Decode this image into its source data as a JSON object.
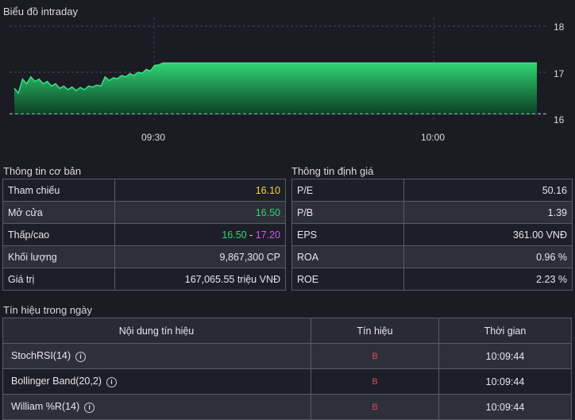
{
  "chart": {
    "title": "Biểu đồ intraday",
    "x_ticks": [
      "09:30",
      "10:00"
    ],
    "y_ticks": [
      "18",
      "17",
      "16"
    ]
  },
  "chart_data": {
    "type": "area",
    "ylim": [
      16,
      18
    ],
    "reference": 16.1,
    "y_ticks": [
      16,
      17,
      18
    ],
    "values": [
      16.65,
      16.55,
      16.85,
      16.75,
      16.9,
      16.8,
      16.85,
      16.75,
      16.8,
      16.7,
      16.75,
      16.65,
      16.7,
      16.62,
      16.68,
      16.6,
      16.67,
      16.62,
      16.7,
      16.68,
      16.72,
      16.7,
      16.9,
      16.82,
      16.88,
      16.86,
      16.93,
      16.9,
      16.97,
      16.93,
      17.0,
      16.98,
      17.06,
      17.03,
      17.15,
      17.16,
      17.2,
      17.2,
      17.2,
      17.2,
      17.2,
      17.2,
      17.2,
      17.2,
      17.2
    ]
  },
  "basic": {
    "heading": "Thông tin cơ bản",
    "rows": [
      {
        "label": "Tham chiếu",
        "value": "16.10"
      },
      {
        "label": "Mở cửa",
        "value": "16.50"
      },
      {
        "label": "Thấp/cao",
        "low": "16.50",
        "sep": " - ",
        "high": "17.20"
      },
      {
        "label": "Khối lượng",
        "value": "9,867,300 CP"
      },
      {
        "label": "Giá trị",
        "value": "167,065.55 triệu VNĐ"
      }
    ]
  },
  "valuation": {
    "heading": "Thông tin định giá",
    "rows": [
      {
        "label": "P/E",
        "value": "50.16"
      },
      {
        "label": "P/B",
        "value": "1.39"
      },
      {
        "label": "EPS",
        "value": "361.00 VNĐ"
      },
      {
        "label": "ROA",
        "value": "0.96 %"
      },
      {
        "label": "ROE",
        "value": "2.23 %"
      }
    ]
  },
  "signals": {
    "heading": "Tín hiệu trong ngày",
    "columns": [
      "Nội dung tín hiệu",
      "Tín hiệu",
      "Thời gian"
    ],
    "rows": [
      {
        "name": "StochRSI(14)",
        "signal": "B",
        "time": "10:09:44"
      },
      {
        "name": "Bollinger Band(20,2)",
        "signal": "B",
        "time": "10:09:44"
      },
      {
        "name": "William %R(14)",
        "signal": "B",
        "time": "10:09:44"
      }
    ]
  },
  "colors": {
    "area_top": "#2ed573",
    "area_bottom": "#0d4a2a",
    "reference_line": "#b0b0b8"
  }
}
